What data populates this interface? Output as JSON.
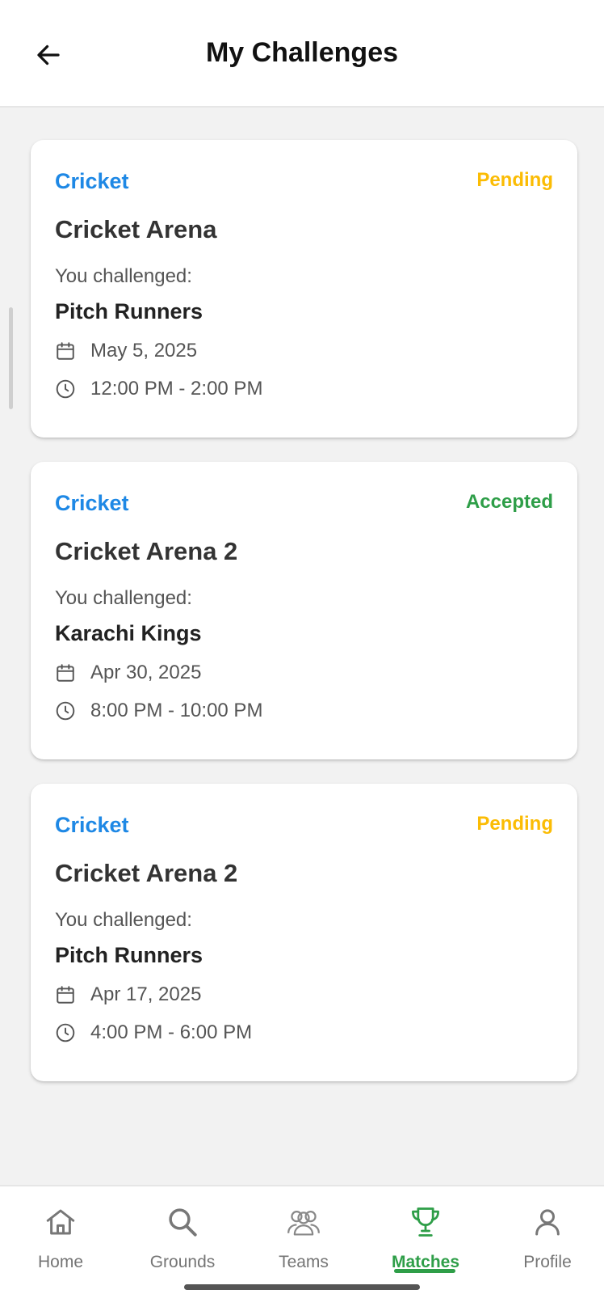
{
  "header": {
    "title": "My Challenges",
    "back_icon": "arrow-left-icon"
  },
  "colors": {
    "sport": "#1e88e5",
    "pending": "#fbbc04",
    "accepted": "#2e9e48",
    "nav_active": "#2e9e48",
    "nav_inactive": "#757575"
  },
  "challenges": [
    {
      "sport": "Cricket",
      "status": "Pending",
      "venue": "Cricket Arena",
      "challenged_label": "You challenged:",
      "team": "Pitch Runners",
      "date": "May 5, 2025",
      "time": "12:00 PM - 2:00 PM"
    },
    {
      "sport": "Cricket",
      "status": "Accepted",
      "venue": "Cricket Arena 2",
      "challenged_label": "You challenged:",
      "team": "Karachi Kings",
      "date": "Apr 30, 2025",
      "time": "8:00 PM - 10:00 PM"
    },
    {
      "sport": "Cricket",
      "status": "Pending",
      "venue": "Cricket Arena 2",
      "challenged_label": "You challenged:",
      "team": "Pitch Runners",
      "date": "Apr 17, 2025",
      "time": "4:00 PM - 6:00 PM"
    }
  ],
  "nav": {
    "active": "Matches",
    "items": [
      {
        "label": "Home",
        "icon": "home-icon"
      },
      {
        "label": "Grounds",
        "icon": "search-icon"
      },
      {
        "label": "Teams",
        "icon": "users-icon"
      },
      {
        "label": "Matches",
        "icon": "trophy-icon"
      },
      {
        "label": "Profile",
        "icon": "user-icon"
      }
    ]
  }
}
